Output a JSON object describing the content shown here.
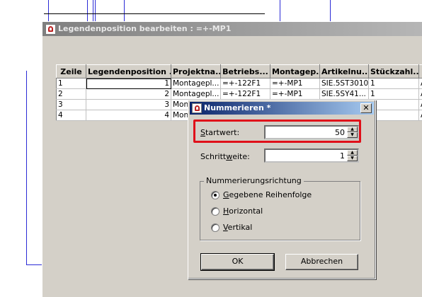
{
  "main_window": {
    "title": "Legendenposition bearbeiten : =+-MP1",
    "columns": [
      "Zeile",
      "Legendenposition ...",
      "Projektna...",
      "Betriebs...",
      "Montagep...",
      "Artikelnu...",
      "Stückzahl...",
      "I"
    ],
    "rows": [
      [
        "1",
        "1",
        "Montagepl...",
        "=+-122F1",
        "=+-MP1",
        "SIE.5ST3010",
        "1",
        "A"
      ],
      [
        "2",
        "2",
        "Montagepl...",
        "=+-122F1",
        "=+-MP1",
        "SIE.5SY41...",
        "1",
        "A"
      ],
      [
        "3",
        "3",
        "Mont",
        "",
        "",
        "",
        "",
        "A"
      ],
      [
        "4",
        "4",
        "Mont",
        "",
        "",
        "",
        "",
        "A"
      ]
    ]
  },
  "dialog": {
    "title": "Nummerieren *",
    "close_label": "✕",
    "startwert": {
      "label_underlined": "S",
      "label_rest": "tartwert:",
      "value": "50"
    },
    "schrittweite": {
      "label_pre": "Schritt",
      "label_underlined": "w",
      "label_rest": "eite:",
      "value": "1"
    },
    "group_label": "Nummerierungsrichtung",
    "radios": [
      {
        "underlined": "G",
        "rest": "egebene Reihenfolge",
        "checked": true
      },
      {
        "underlined": "H",
        "rest": "orizontal",
        "checked": false
      },
      {
        "underlined": "V",
        "rest": "ertikal",
        "checked": false
      }
    ],
    "ok_label": "OK",
    "cancel_label": "Abbrechen"
  },
  "colors": {
    "highlight": "#e0101a",
    "titlebar_active": "#0a246a",
    "schematic_lines": "#2a2ad6"
  },
  "icons": [
    "app-icon",
    "close-icon",
    "spin-up-icon",
    "spin-down-icon"
  ]
}
